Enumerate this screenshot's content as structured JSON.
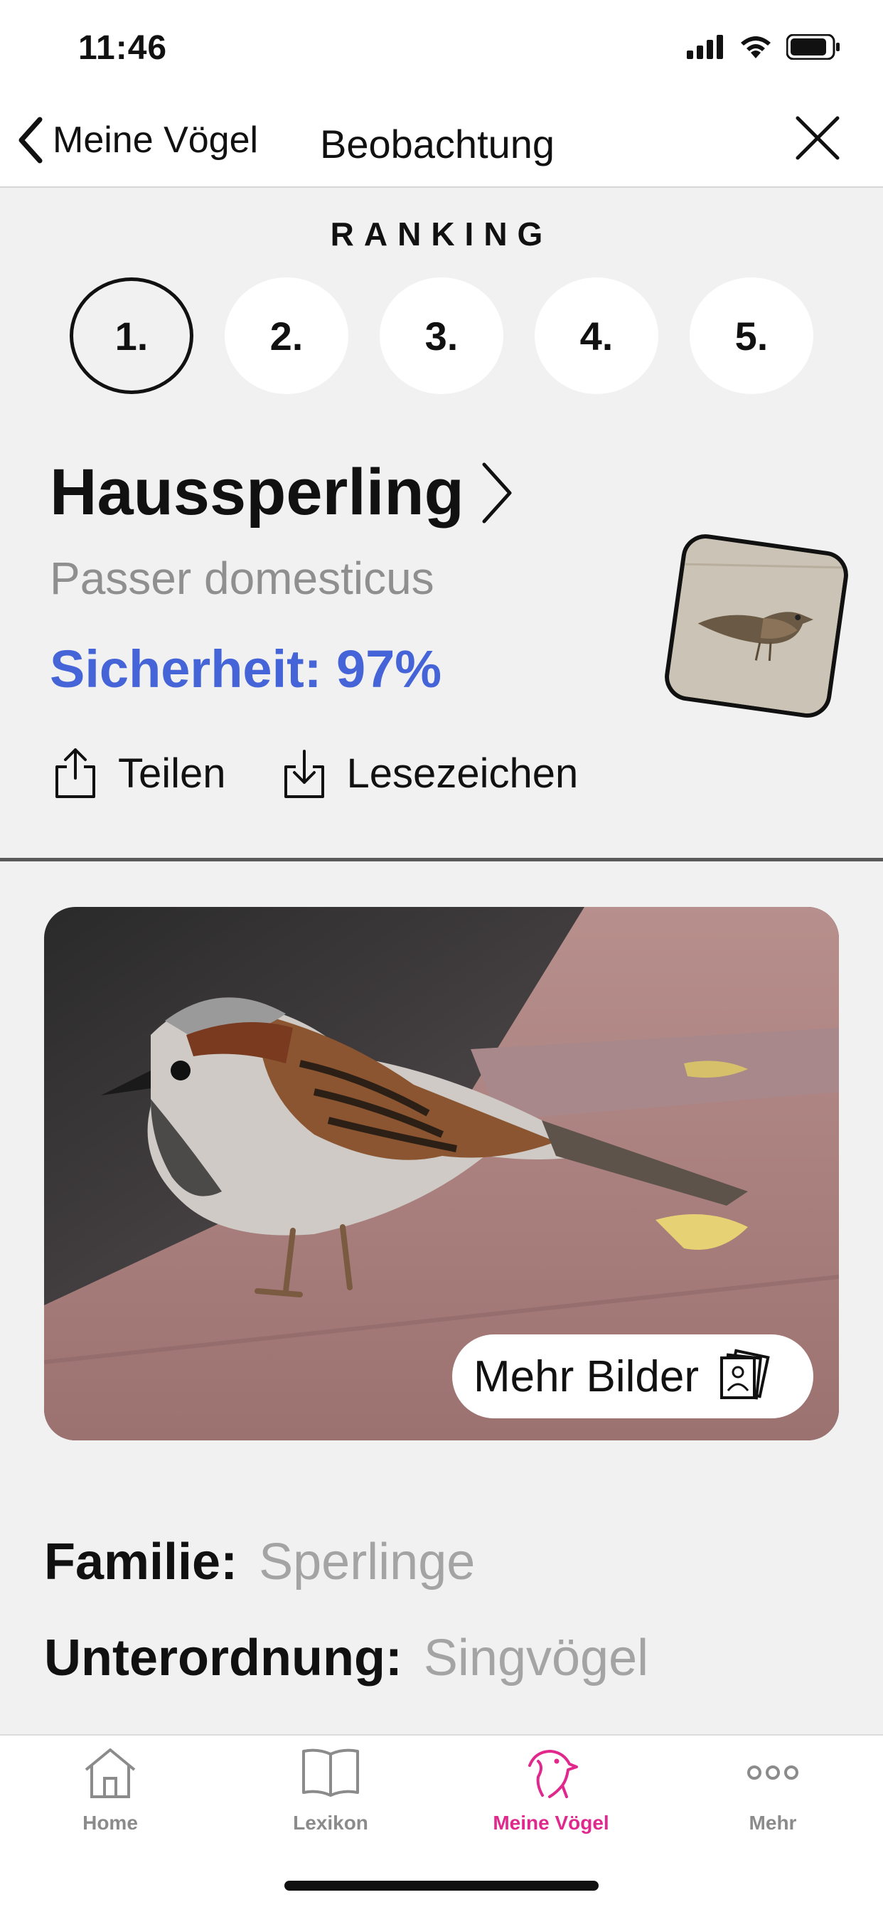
{
  "status_bar": {
    "time": "11:46"
  },
  "nav": {
    "back_label": "Meine Vögel",
    "title": "Beobachtung"
  },
  "ranking": {
    "label": "RANKING",
    "items": [
      "1.",
      "2.",
      "3.",
      "4.",
      "5."
    ],
    "selected": "1."
  },
  "species": {
    "name": "Haussperling",
    "scientific": "Passer domesticus",
    "confidence": "Sicherheit: 97%"
  },
  "actions": {
    "share_label": "Teilen",
    "bookmark_label": "Lesezeichen"
  },
  "photo": {
    "more_label": "Mehr Bilder"
  },
  "details": [
    {
      "key": "Familie:",
      "value": "Sperlinge"
    },
    {
      "key": "Unterordnung:",
      "value": "Singvögel"
    }
  ],
  "tabs": [
    {
      "label": "Home",
      "icon": "home-icon"
    },
    {
      "label": "Lexikon",
      "icon": "book-icon"
    },
    {
      "label": "Meine Vögel",
      "icon": "bird-icon",
      "active": true
    },
    {
      "label": "Mehr",
      "icon": "more-icon"
    }
  ],
  "colors": {
    "accent_blue": "#4464d8",
    "active_tab": "#e0288d"
  }
}
